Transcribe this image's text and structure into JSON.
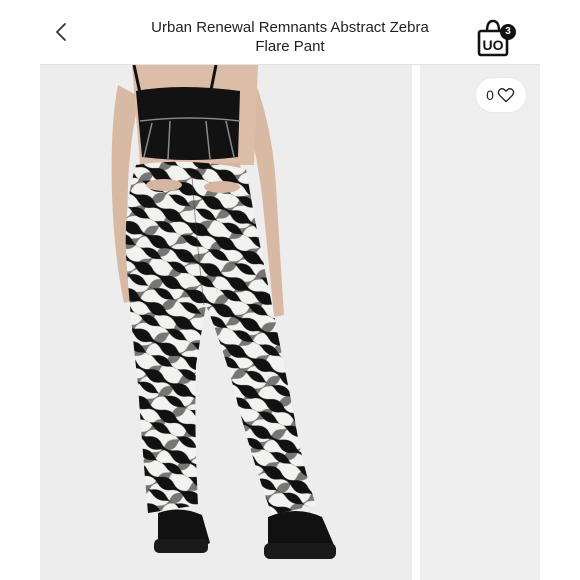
{
  "header": {
    "title_line1": "Urban Renewal Remnants Abstract Zebra",
    "title_line2": "Flare Pant",
    "brand_logo": "UO",
    "bag_count": "3"
  },
  "product": {
    "likes_count": "0"
  },
  "icons": {
    "back": "chevron-left-icon",
    "bag": "shopping-bag-icon",
    "like": "heart-icon"
  },
  "colors": {
    "text": "#222222",
    "badge": "#111111",
    "photo_bg": "#ededed",
    "zebra_dark": "#111111",
    "zebra_light": "#f2f2f0"
  }
}
